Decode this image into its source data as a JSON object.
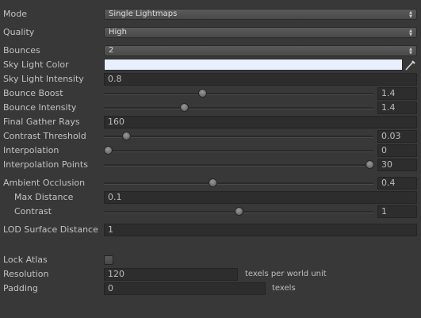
{
  "mode": {
    "label": "Mode",
    "value": "Single Lightmaps"
  },
  "quality": {
    "label": "Quality",
    "value": "High"
  },
  "bounces": {
    "label": "Bounces",
    "value": "2"
  },
  "sky_light_color": {
    "label": "Sky Light Color",
    "color": "#e8f0ff"
  },
  "sky_light_intensity": {
    "label": "Sky Light Intensity",
    "value": "0.8"
  },
  "bounce_boost": {
    "label": "Bounce Boost",
    "value": "1.4",
    "level": 0.36
  },
  "bounce_intensity": {
    "label": "Bounce Intensity",
    "value": "1.4",
    "level": 0.29
  },
  "final_gather_rays": {
    "label": "Final Gather Rays",
    "value": "160"
  },
  "contrast_threshold": {
    "label": "Contrast Threshold",
    "value": "0.03",
    "level": 0.07
  },
  "interpolation": {
    "label": "Interpolation",
    "value": "0",
    "level": 0.0
  },
  "interpolation_points": {
    "label": "Interpolation Points",
    "value": "30",
    "level": 1.0
  },
  "ambient_occlusion": {
    "label": "Ambient Occlusion",
    "value": "0.4",
    "level": 0.4
  },
  "max_distance": {
    "label": "Max Distance",
    "value": "0.1"
  },
  "contrast": {
    "label": "Contrast",
    "value": "1",
    "level": 0.5
  },
  "lod_surface_distance": {
    "label": "LOD Surface Distance",
    "value": "1"
  },
  "lock_atlas": {
    "label": "Lock Atlas",
    "checked": false
  },
  "resolution": {
    "label": "Resolution",
    "value": "120",
    "suffix": "texels per world unit"
  },
  "padding": {
    "label": "Padding",
    "value": "0",
    "suffix": "texels"
  },
  "icons": {
    "dropdown_arrow": "updown-arrow-icon",
    "color_picker": "eyedropper-icon"
  }
}
